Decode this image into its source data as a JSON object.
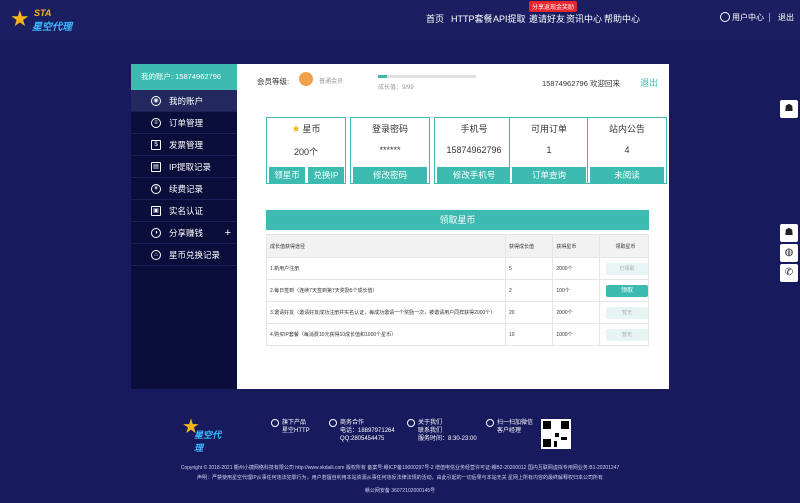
{
  "header": {
    "brand": {
      "sta": "STA",
      "name": "星空代理"
    },
    "nav": [
      "首页",
      "HTTP套餐",
      "API提取",
      "邀请好友",
      "资讯中心",
      "帮助中心"
    ],
    "promo_badge": "分享返现金奖励",
    "user_center": "用户中心",
    "logout": "退出"
  },
  "sidebar": {
    "account_label": "我的账户: 15874962796",
    "items": [
      {
        "label": "我的账户",
        "icon": "user-icon",
        "active": true
      },
      {
        "label": "订单管理",
        "icon": "order-icon"
      },
      {
        "label": "发票管理",
        "icon": "invoice-icon"
      },
      {
        "label": "IP提取记录",
        "icon": "record-icon"
      },
      {
        "label": "续费记录",
        "icon": "renew-icon"
      },
      {
        "label": "实名认证",
        "icon": "id-card-icon"
      },
      {
        "label": "分享赚钱",
        "icon": "share-icon"
      },
      {
        "label": "星币兑换记录",
        "icon": "exchange-icon"
      }
    ]
  },
  "member": {
    "level_label": "会员等级:",
    "level_name": "普通会员",
    "growth_text": "成长值：9/99",
    "growth_progress": 0.09,
    "welcome": "15874962796 欢迎回来",
    "exit": "退出"
  },
  "cards": [
    {
      "title": "星币",
      "value": "200个",
      "buttons": [
        "领星币",
        "兑换IP"
      ]
    },
    {
      "title": "登录密码",
      "value": "******",
      "buttons": [
        "修改密码"
      ]
    },
    {
      "title": "手机号",
      "value": "15874962796",
      "buttons": [
        "修改手机号"
      ]
    },
    {
      "title": "可用订单",
      "value": "1",
      "buttons": [
        "订单查询"
      ]
    },
    {
      "title": "站内公告",
      "value": "4",
      "buttons": [
        "未阅读"
      ]
    }
  ],
  "section_title": "领取星币",
  "table": {
    "headers": [
      "成长值获得途径",
      "获得成长值",
      "获得星币",
      "领取星币"
    ],
    "rows": [
      {
        "way": "1.新用户注册",
        "growth": "5",
        "coins": "2000个",
        "action": "已领取",
        "enabled": false
      },
      {
        "way": "2.每日签到（连续7天签到第7天奖励5个成长值）",
        "growth": "2",
        "coins": "100个",
        "action": "领取",
        "enabled": true
      },
      {
        "way": "3.邀请好友（邀请好友成功注册并实名认证，每成功邀请一个奖励一次，被邀请用户同样获得2000个）",
        "growth": "20",
        "coins": "2000个",
        "action": "暂无",
        "enabled": false
      },
      {
        "way": "4.购买IP套餐（每消费10元获得10成长值和1000个星币）",
        "growth": "10",
        "coins": "1000个",
        "action": "暂无",
        "enabled": false
      }
    ]
  },
  "footer": {
    "brand": "星空代理",
    "product": {
      "title": "旗下产品",
      "line": "星空HTTP"
    },
    "business": {
      "title": "商务合作",
      "phone": "电话：18897971264",
      "qq": "QQ:2805454475"
    },
    "about": {
      "title": "关于我们",
      "contact": "联系我们",
      "hours": "服务时间：8:30-23:00"
    },
    "wechat": {
      "title": "扫一扫加微信",
      "sub": "客户经理"
    },
    "copyright": "Copyright © 2018-2021  衢州小捷网络科技有限公司 http://www.xkdaili.com 版权所有   备案号:赣ICP备19000297号-2   增值电信业务经营许可证:赣B2-20200012   国内互联网虚拟专用网业务:B1-20201247",
    "declaration": "声明：严禁使用星空代理IP从事任何违法犯罪行为，用户若擅自利用本站资源从事任何违反法律法规的活动，由此引起的一切后果与本站无关 星网上所有内容的最终解释权归本公司所有",
    "police": "赣公网安备 36072102000145号"
  }
}
